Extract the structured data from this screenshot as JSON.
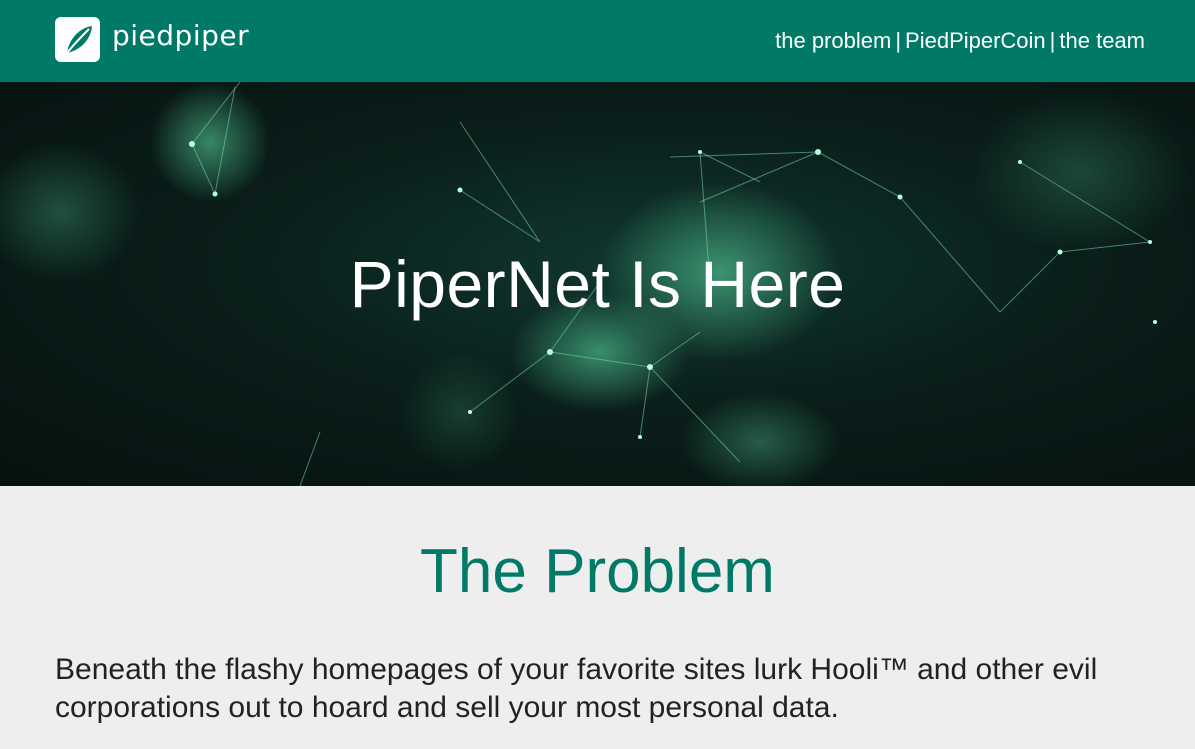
{
  "brand": {
    "name": "piedpiper",
    "logo_icon": "leaf-logo-icon"
  },
  "nav": {
    "links": [
      "the problem",
      "PiedPiperCoin",
      "the team"
    ],
    "separator": "|"
  },
  "hero": {
    "title": "PiperNet Is Here"
  },
  "problem": {
    "title": "The Problem",
    "body": "Beneath the flashy homepages of your favorite sites lurk Hooli™ and other evil corporations out to hoard and sell your most personal data."
  },
  "colors": {
    "brand_green": "#007a67",
    "page_background": "#eeeeee",
    "hero_background": "#0a1e1a",
    "text_dark": "#222222"
  }
}
